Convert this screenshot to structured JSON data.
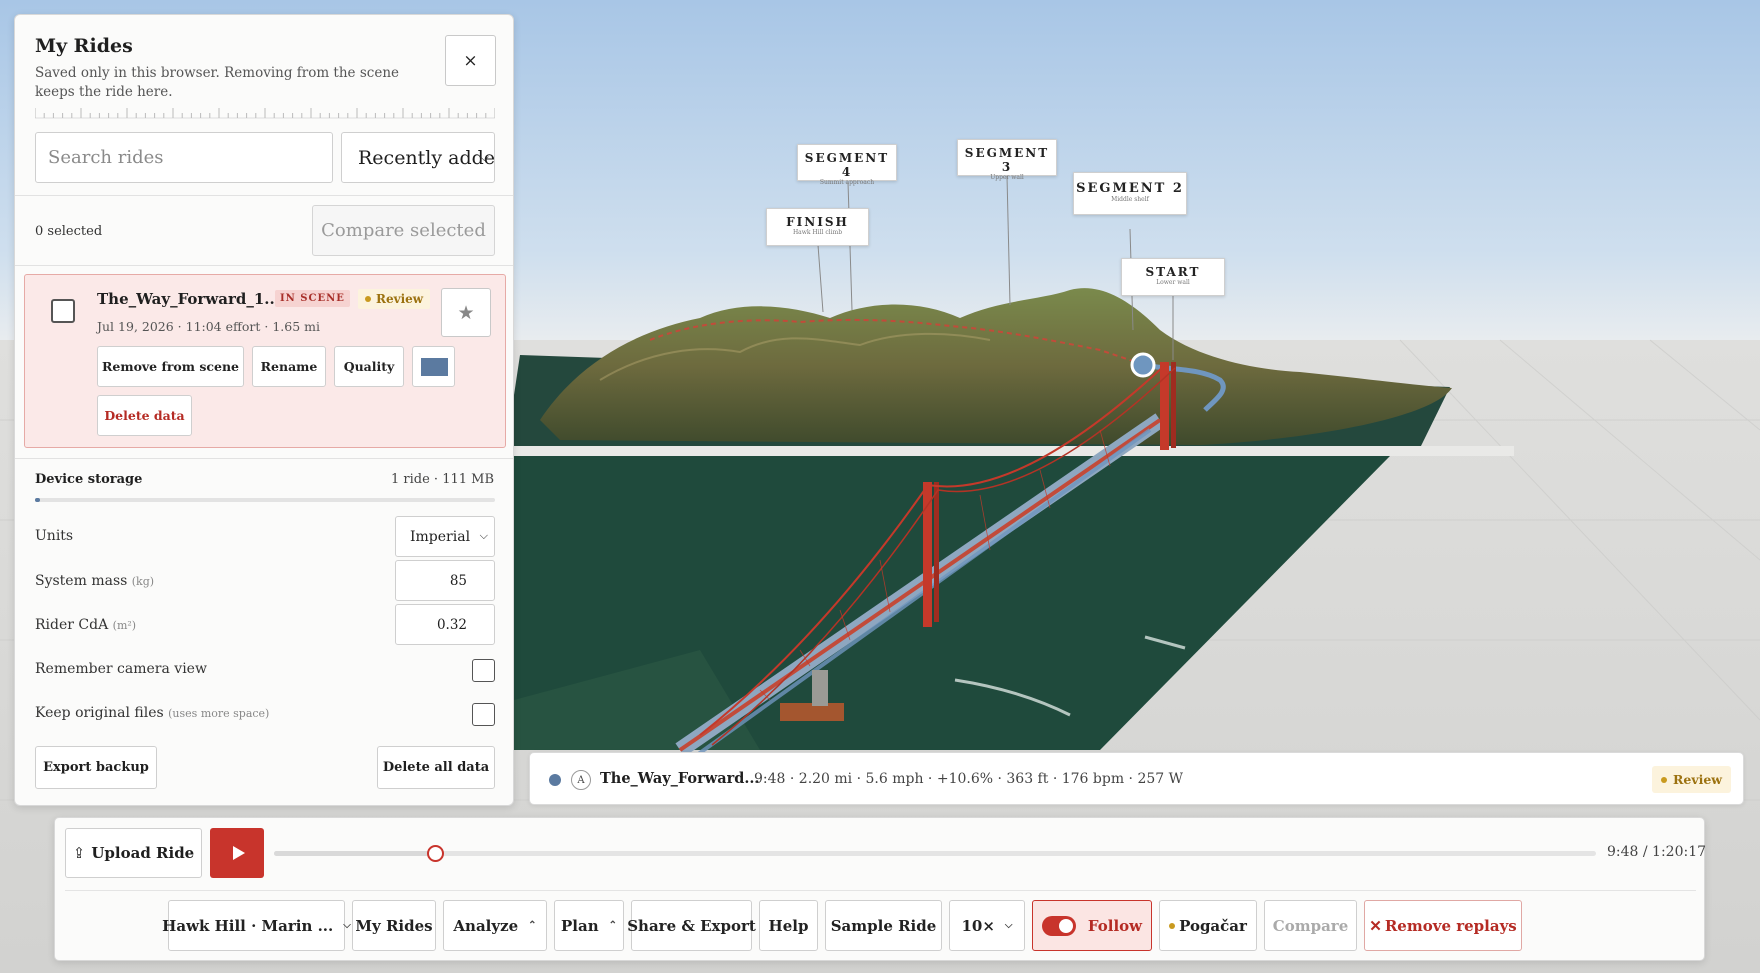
{
  "scene": {
    "labels": [
      {
        "title": "SEGMENT 4",
        "sub": "Summit approach"
      },
      {
        "title": "SEGMENT 3",
        "sub": "Upper wall"
      },
      {
        "title": "SEGMENT 2",
        "sub": "Middle shelf"
      },
      {
        "title": "FINISH",
        "sub": "Hawk Hill climb"
      },
      {
        "title": "START",
        "sub": "Lower wall"
      }
    ]
  },
  "panel": {
    "title": "My Rides",
    "subtitle": "Saved only in this browser. Removing from the scene keeps the ride here.",
    "close_label": "×",
    "search_placeholder": "Search rides",
    "sort_value": "Recently added",
    "selected_count": "0 selected",
    "compare_selected": "Compare selected",
    "ride": {
      "name": "The_Way_Forward_1...",
      "in_scene": "IN SCENE",
      "review": "Review",
      "meta": "Jul 19, 2026 · 11:04 effort · 1.65 mi",
      "star": "★",
      "remove_from_scene": "Remove from scene",
      "rename": "Rename",
      "quality": "Quality",
      "delete_data": "Delete data",
      "color": "#5b7aa0"
    },
    "storage": {
      "label": "Device storage",
      "value": "1 ride · 111 MB",
      "fill_fraction": 0.01
    },
    "settings": {
      "units_label": "Units",
      "units_value": "Imperial",
      "mass_label": "System mass",
      "mass_unit": "(kg)",
      "mass_value": "85",
      "cda_label": "Rider CdA",
      "cda_unit": "(m²)",
      "cda_value": "0.32",
      "camera_label": "Remember camera view",
      "keep_label": "Keep original files",
      "keep_note": "(uses more space)"
    },
    "export_backup": "Export backup",
    "delete_all": "Delete all data"
  },
  "ride_info": {
    "letter": "A",
    "name": "The_Way_Forward...",
    "stats": "9:48 · 2.20 mi · 5.6 mph · +10.6% · 363 ft · 176 bpm · 257 W",
    "review": "Review"
  },
  "controls": {
    "upload": "Upload Ride",
    "upload_icon": "⇪",
    "progress_fraction": 0.122,
    "time": "9:48 / 1:20:17",
    "route": "Hawk Hill · Marin ...",
    "my_rides": "My Rides",
    "analyze": "Analyze",
    "plan": "Plan",
    "share_export": "Share & Export",
    "help": "Help",
    "sample_ride": "Sample Ride",
    "speed": "10×",
    "follow": "Follow",
    "pogacar": "Pogačar",
    "compare": "Compare",
    "remove_replays": "Remove replays"
  }
}
